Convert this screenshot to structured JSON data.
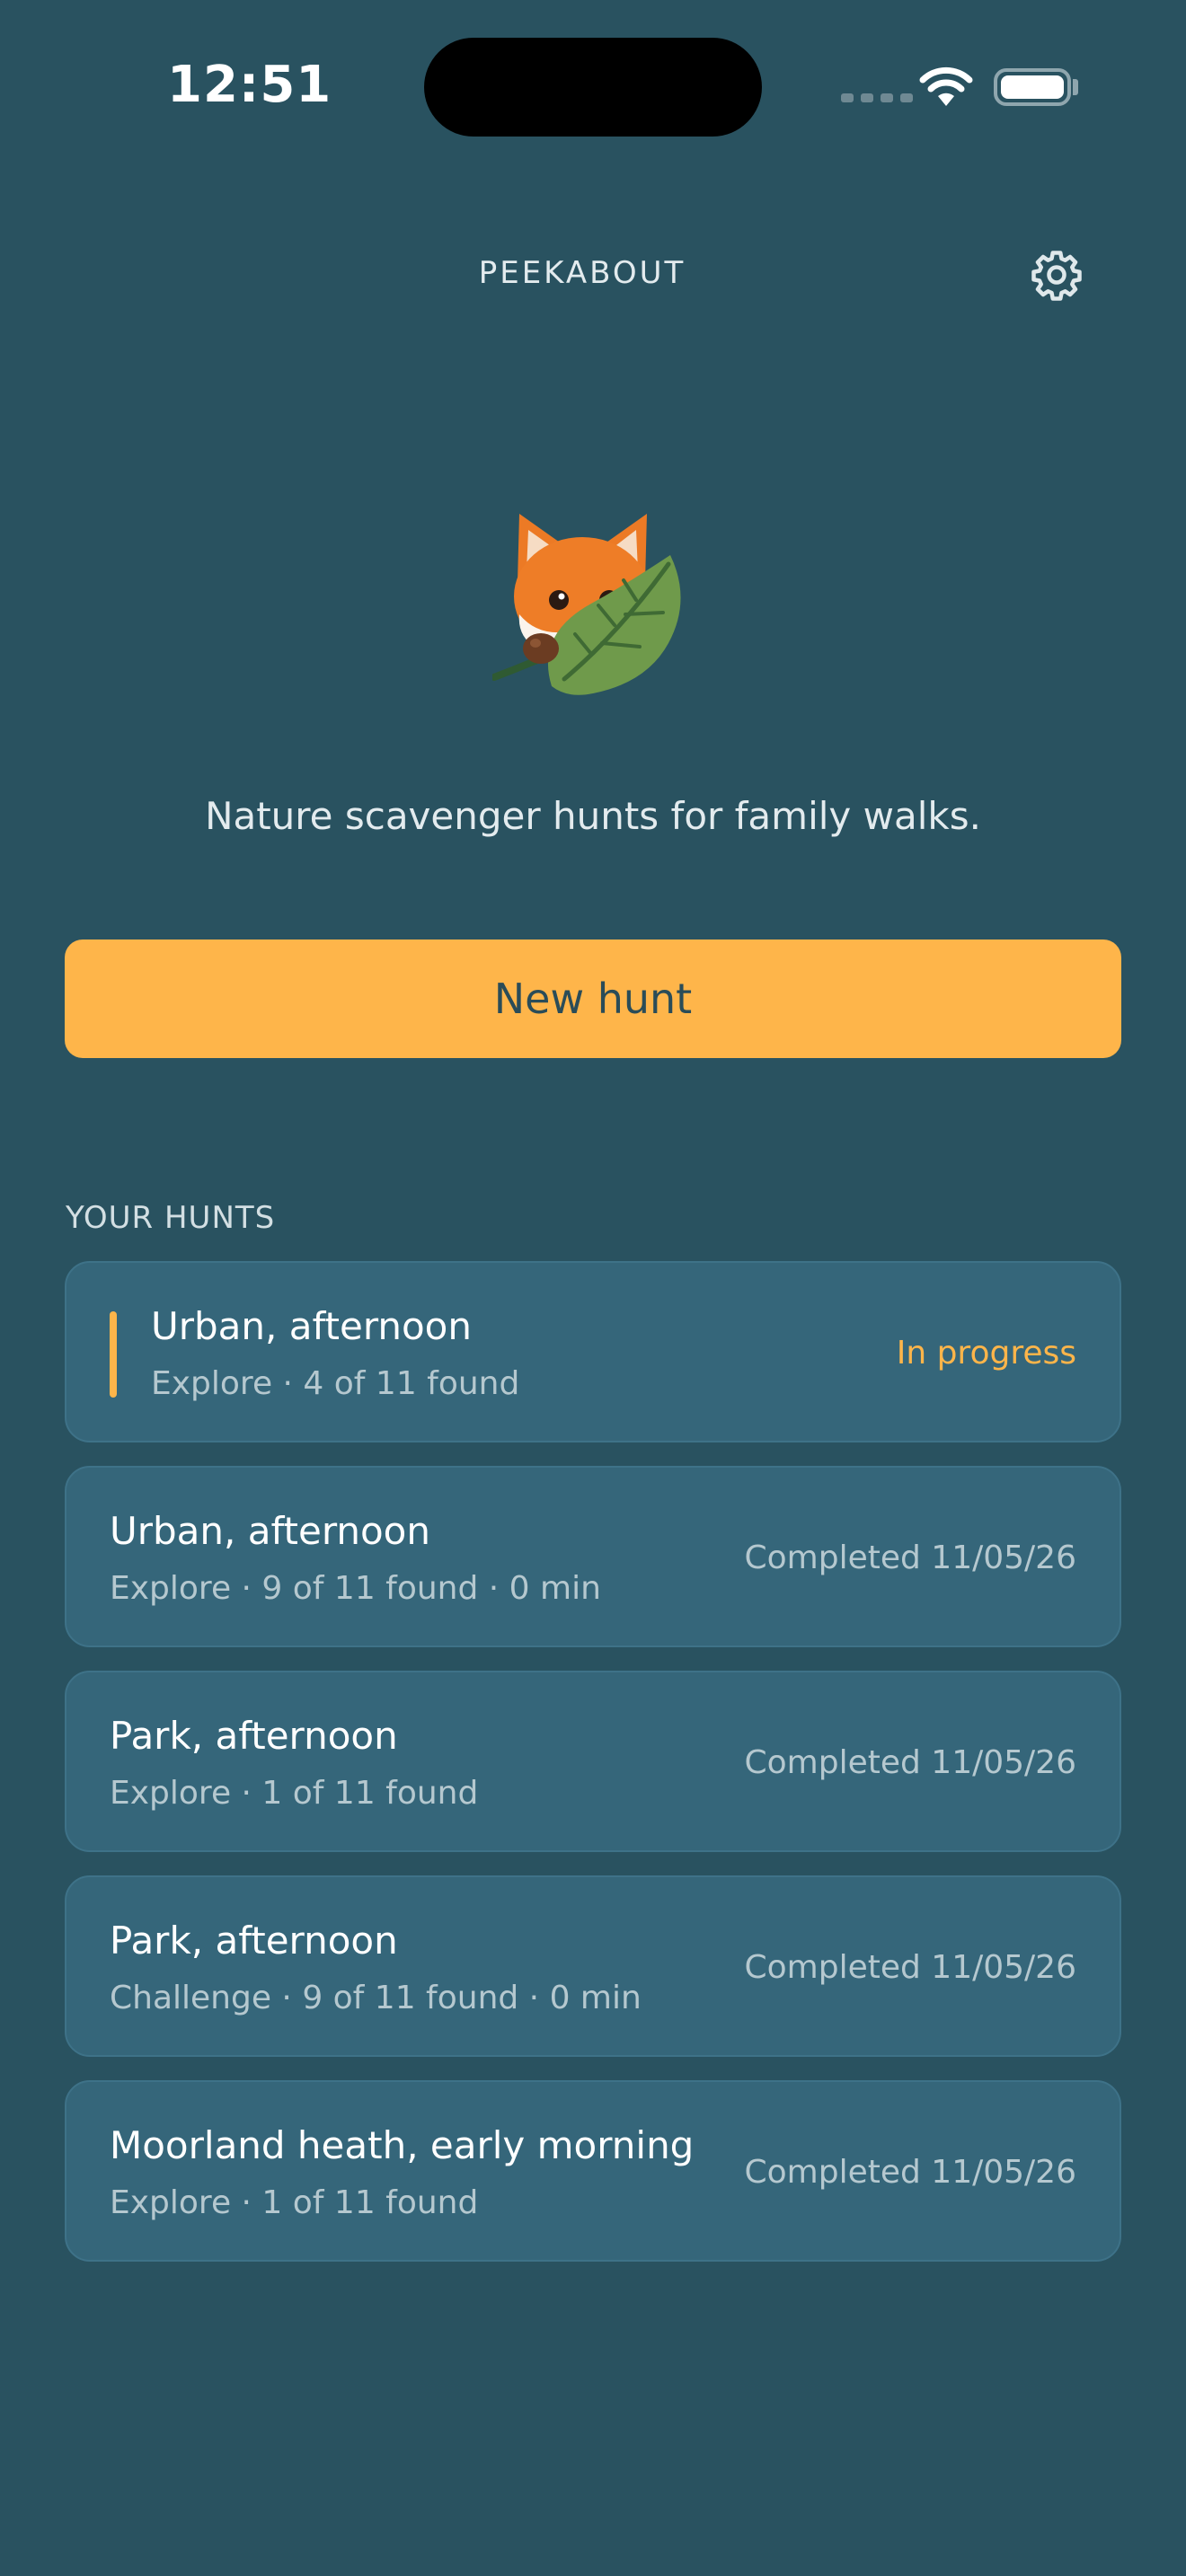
{
  "status_bar": {
    "time": "12:51"
  },
  "header": {
    "title": "PEEKABOUT",
    "settings_icon": "gear-icon"
  },
  "hero": {
    "mascot_icon": "fox-with-leaf-illustration",
    "tagline": "Nature scavenger hunts for family walks."
  },
  "actions": {
    "new_hunt_label": "New hunt"
  },
  "hunts": {
    "section_label": "YOUR HUNTS",
    "items": [
      {
        "title": "Urban, afternoon",
        "subtitle": "Explore · 4 of 11 found",
        "status": "In progress"
      },
      {
        "title": "Urban, afternoon",
        "subtitle": "Explore · 9 of 11 found · 0 min",
        "status": "Completed 11/05/26"
      },
      {
        "title": "Park, afternoon",
        "subtitle": "Explore · 1 of 11 found",
        "status": "Completed 11/05/26"
      },
      {
        "title": "Park, afternoon",
        "subtitle": "Challenge · 9 of 11 found · 0 min",
        "status": "Completed 11/05/26"
      },
      {
        "title": "Moorland heath, early morning",
        "subtitle": "Explore · 1 of 11 found",
        "status": "Completed 11/05/26"
      }
    ]
  },
  "colors": {
    "background": "#295260",
    "accent": "#feb54a",
    "card": "#35667a"
  }
}
